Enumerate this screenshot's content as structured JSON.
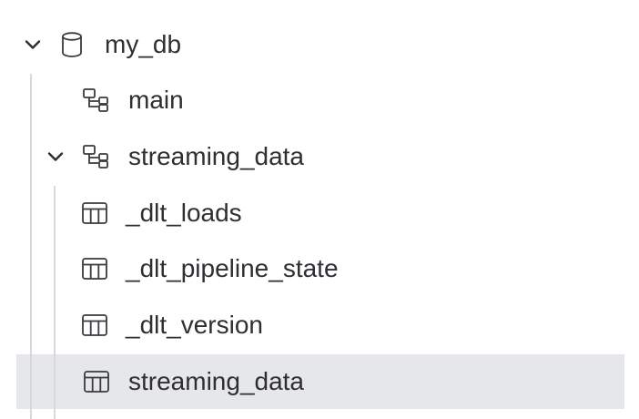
{
  "tree": {
    "database": {
      "label": "my_db",
      "icon": "database-icon",
      "expanded": true
    },
    "schemas": [
      {
        "label": "main",
        "icon": "schema-icon",
        "expanded": false
      },
      {
        "label": "streaming_data",
        "icon": "schema-icon",
        "expanded": true,
        "tables": [
          {
            "label": "_dlt_loads",
            "icon": "table-icon",
            "selected": false
          },
          {
            "label": "_dlt_pipeline_state",
            "icon": "table-icon",
            "selected": false
          },
          {
            "label": "_dlt_version",
            "icon": "table-icon",
            "selected": false
          },
          {
            "label": "streaming_data",
            "icon": "table-icon",
            "selected": true
          }
        ]
      }
    ],
    "colors": {
      "selected_background": "#e6e7ea",
      "guide_line": "#d8d9dc",
      "text": "#2f2f33"
    }
  }
}
